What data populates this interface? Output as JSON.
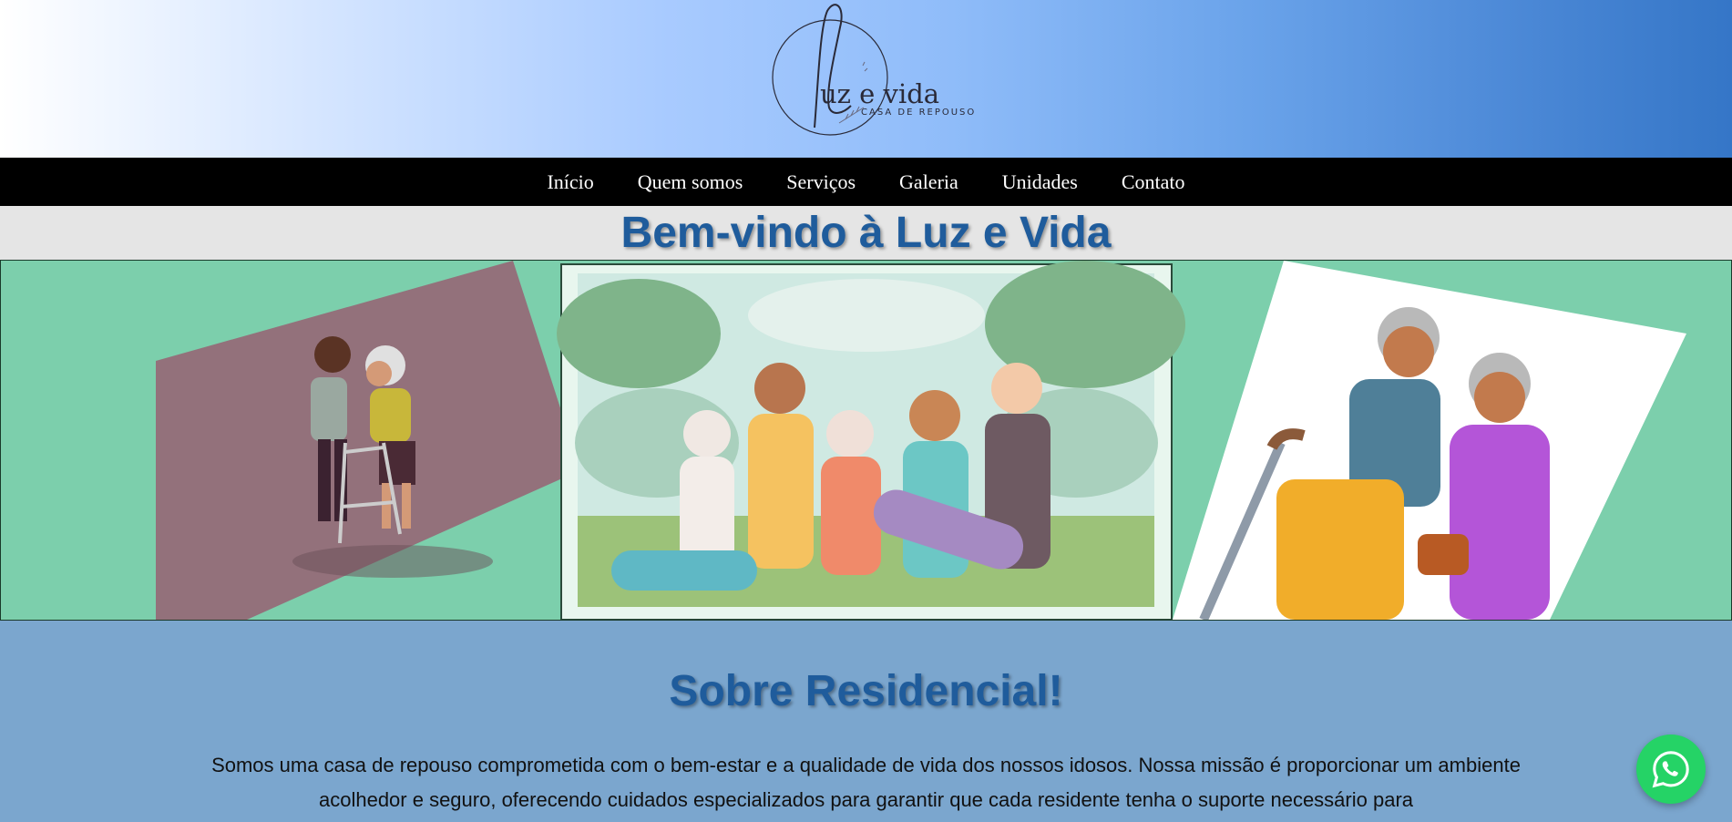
{
  "brand": {
    "logo_script": "uz e vida",
    "logo_initial": "l",
    "logo_subtitle": "CASA DE REPOUSO"
  },
  "nav": {
    "items": [
      {
        "label": "Início"
      },
      {
        "label": "Quem somos"
      },
      {
        "label": "Serviços"
      },
      {
        "label": "Galeria"
      },
      {
        "label": "Unidades"
      },
      {
        "label": "Contato"
      }
    ]
  },
  "welcome": {
    "title": "Bem-vindo à Luz e Vida"
  },
  "about": {
    "title": "Sobre Residencial!",
    "text": "Somos uma casa de repouso comprometida com o bem-estar e a qualidade de vida dos nossos idosos. Nossa missão é proporcionar um ambiente acolhedor e seguro, oferecendo cuidados especializados para garantir que cada residente tenha o suporte necessário para"
  },
  "colors": {
    "nav_bg": "#000000",
    "heading": "#1f5c9c",
    "banner_bg": "#7ccfac",
    "about_bg": "#7ba6ce",
    "whatsapp": "#25d366"
  },
  "icons": {
    "whatsapp": "whatsapp-icon"
  }
}
